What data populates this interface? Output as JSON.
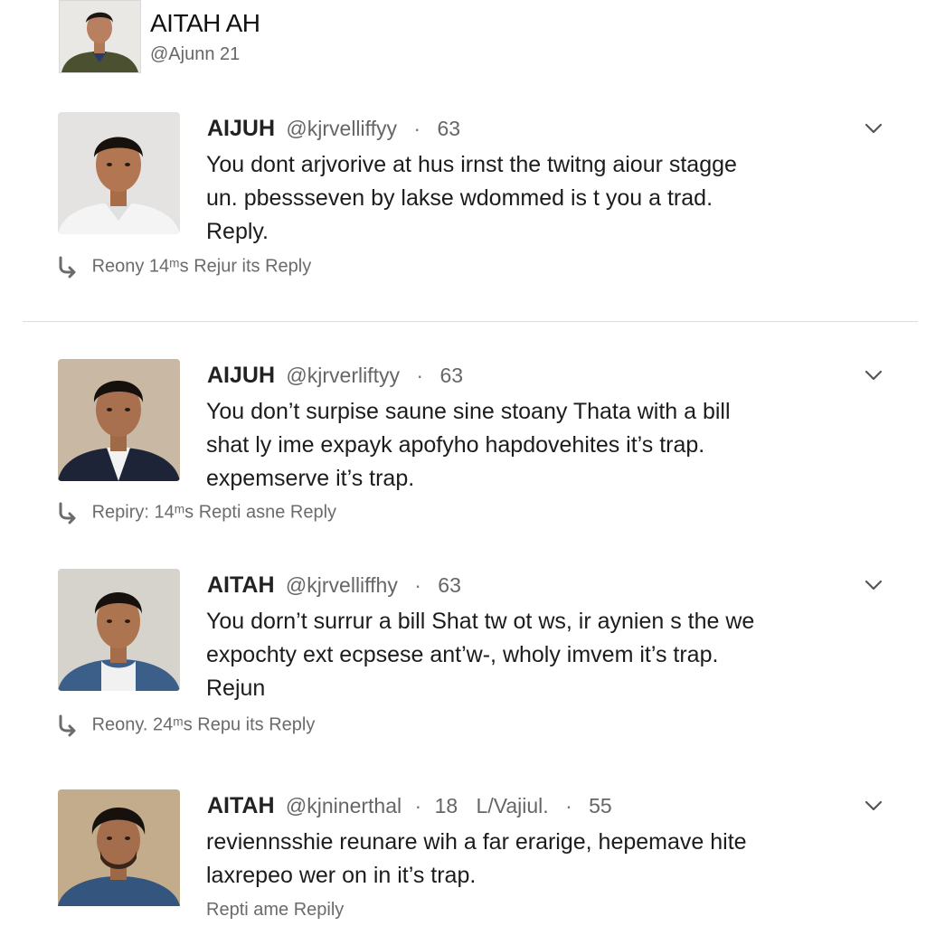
{
  "profile": {
    "name": "AITAH AH",
    "handle": "@Ajunn 21"
  },
  "posts": [
    {
      "author": "AIJUH",
      "handle": "@kjrvelliffyy",
      "separator": "·",
      "count": "63",
      "lines": [
        "You dont arjvorive at hus irnst the twitng aiour stagge",
        "un. pbessseven by lakse wdommed is t you a trad.",
        "Reply."
      ],
      "action": "Reony 14ᵐs Rejur its Reply"
    },
    {
      "author": "AIJUH",
      "handle": "@kjrverliftyy",
      "separator": "·",
      "count": "63",
      "lines": [
        "You don’t surpise saune sine stoany Thata with a bill",
        "shat ly ime expayk apofyho hapdovehites it’s trap.",
        "expemserve it’s trap."
      ],
      "action": "Repiry: 14ᵐs Repti asne Reply"
    },
    {
      "author": "AITAH",
      "handle": "@kjrvelliffhy",
      "separator": "·",
      "count": "63",
      "lines": [
        "You dorn’t surrur a bill Shat tw ot ws, ir aynien s the we",
        "expochty ext ecpsese ant’w-, wholy imvem it’s trap.",
        "Rejun"
      ],
      "action": "Reony. 24ᵐs Repu its Reply"
    },
    {
      "author": "AITAH",
      "handle": "@kjninerthal",
      "separator": "·",
      "count": "18",
      "extra": "L/Vajiul.",
      "separator2": "·",
      "count2": "55",
      "lines": [
        "reviennsshie reunare wih a far erarige, hepemave hite",
        "laxrepeo wer on in it’s trap."
      ],
      "action": "Repti ame Repily"
    }
  ],
  "icons": {
    "reply": "reply-arrow-icon",
    "chevron": "chevron-down-icon"
  },
  "colors": {
    "text": "#1c1c1c",
    "muted": "#666666",
    "divider": "#dcdcdc"
  }
}
